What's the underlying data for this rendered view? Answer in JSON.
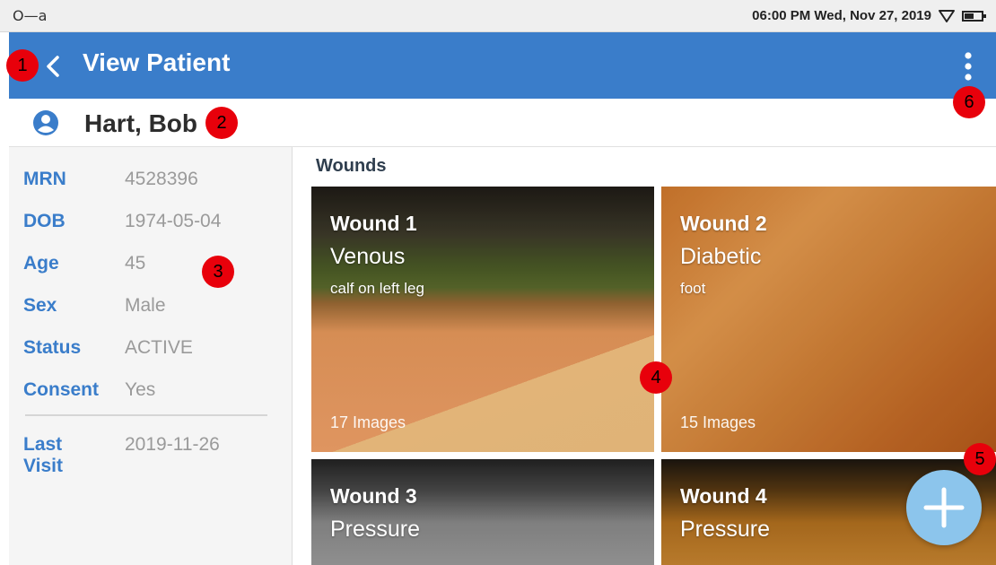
{
  "status_bar": {
    "left_text": "O—a",
    "time_date": "06:00 PM  Wed, Nov 27, 2019"
  },
  "app_bar": {
    "title": "View Patient",
    "back_icon": "chevron-left-icon",
    "menu_icon": "more-vertical-icon",
    "color": "#3a7dca"
  },
  "patient": {
    "name": "Hart, Bob",
    "icon": "account-circle-icon",
    "info": [
      {
        "label": "MRN",
        "value": "4528396"
      },
      {
        "label": "DOB",
        "value": "1974-05-04"
      },
      {
        "label": "Age",
        "value": "45"
      },
      {
        "label": "Sex",
        "value": "Male"
      },
      {
        "label": "Status",
        "value": "ACTIVE"
      },
      {
        "label": "Consent",
        "value": "Yes"
      }
    ],
    "last_visit": {
      "label": "Last Visit",
      "value": "2019-11-26"
    }
  },
  "wounds": {
    "title": "Wounds",
    "items": [
      {
        "name": "Wound 1",
        "type": "Venous",
        "location": "calf on left leg",
        "images": "17 Images"
      },
      {
        "name": "Wound 2",
        "type": "Diabetic",
        "location": "foot",
        "images": "15 Images"
      },
      {
        "name": "Wound 3",
        "type": "Pressure"
      },
      {
        "name": "Wound 4",
        "type": "Pressure"
      }
    ]
  },
  "fab": {
    "icon": "plus-icon",
    "color": "#8cc5ec"
  },
  "markers": [
    "1",
    "2",
    "3",
    "4",
    "5",
    "6"
  ]
}
